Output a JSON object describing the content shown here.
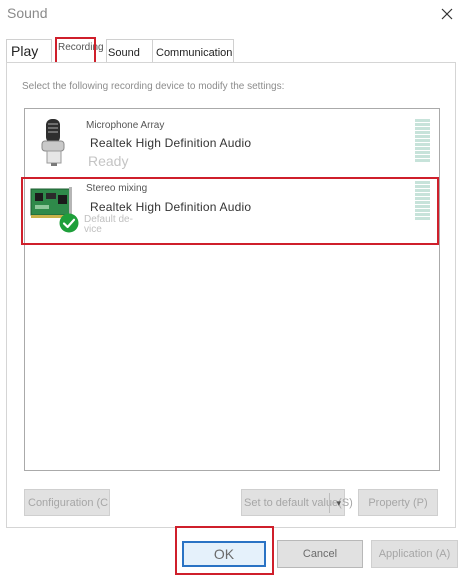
{
  "window": {
    "title": "Sound"
  },
  "tabs": [
    {
      "label": "Play"
    },
    {
      "label": "Recording"
    },
    {
      "label": "Sound"
    },
    {
      "label": "Communication"
    }
  ],
  "panel": {
    "instruction": "Select the following recording device to modify the settings:"
  },
  "devices": [
    {
      "name": "Microphone Array",
      "description": "Realtek High Definition Audio",
      "status": "Ready",
      "icon": "microphone-icon"
    },
    {
      "name": "Stereo mixing",
      "description": "Realtek High Definition Audio",
      "status_line1": "Default de-",
      "status_line2": "vice",
      "icon": "sound-card-icon",
      "badge_icon": "default-check-icon"
    }
  ],
  "buttons": {
    "configuration": "Configuration (C",
    "set_default": "Set to default value(S)",
    "property": "Property (P)",
    "ok": "OK",
    "cancel": "Cancel",
    "apply": "Application (A)"
  },
  "colors": {
    "highlight_box": "#cf1f2b",
    "ok_border": "#2a73c4",
    "check_badge": "#1e9f3a"
  }
}
